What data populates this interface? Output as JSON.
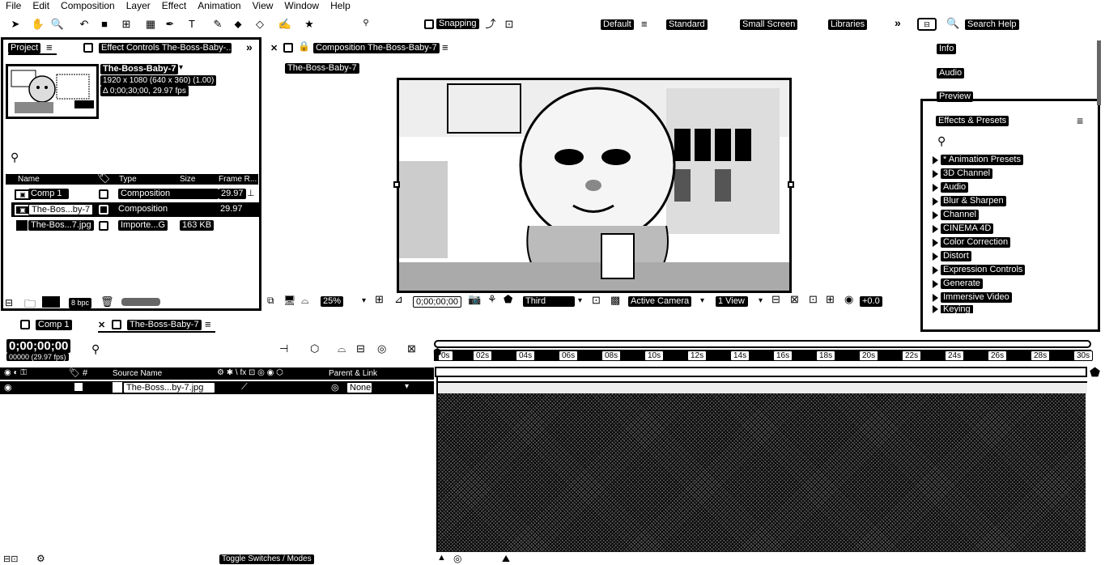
{
  "menu": [
    "File",
    "Edit",
    "Composition",
    "Layer",
    "Effect",
    "Animation",
    "View",
    "Window",
    "Help"
  ],
  "toolbar": {
    "snapping_label": "Snapping",
    "workspaces": [
      "Default",
      "Standard",
      "Small Screen",
      "Libraries"
    ],
    "search_help": "Search Help"
  },
  "project_panel": {
    "tab_project": "Project",
    "tab_effect_controls": "Effect Controls The-Boss-Baby-...",
    "item_name": "The-Boss-Baby-7",
    "item_dimensions": "1920 x 1080  (640 x 360) (1.00)",
    "item_duration": "Δ 0;00;30;00, 29.97 fps",
    "columns": [
      "Name",
      "Type",
      "Size",
      "Frame R..."
    ],
    "rows": [
      {
        "name": "Comp 1",
        "type": "Composition",
        "size": "",
        "frame_rate": "29.97"
      },
      {
        "name": "The-Bos...by-7",
        "type": "Composition",
        "size": "",
        "frame_rate": "29.97"
      },
      {
        "name": "The-Bos...7.jpg",
        "type": "Importe...G",
        "size": "163 KB",
        "frame_rate": ""
      }
    ],
    "bpc": "8 bpc"
  },
  "composition_panel": {
    "tab_title": "Composition The-Boss-Baby-7",
    "breadcrumb": "The-Boss-Baby-7",
    "zoom": "25%",
    "timecode": "0;00;00;00",
    "resolution": "Third",
    "camera": "Active Camera",
    "views": "1 View",
    "exposure": "+0.0"
  },
  "right_panel": {
    "info": "Info",
    "audio": "Audio",
    "preview": "Preview",
    "effects_title": "Effects & Presets",
    "effects": [
      "* Animation Presets",
      "3D Channel",
      "Audio",
      "Blur & Sharpen",
      "Channel",
      "CINEMA 4D",
      "Color Correction",
      "Distort",
      "Expression Controls",
      "Generate",
      "Immersive Video",
      "Keying"
    ]
  },
  "timeline": {
    "tab_comp1": "Comp 1",
    "tab_boss": "The-Boss-Baby-7",
    "timecode": "0;00;00;00",
    "frame_info": "00000 (29.97 fps)",
    "ticks": [
      "0s",
      "02s",
      "04s",
      "06s",
      "08s",
      "10s",
      "12s",
      "14s",
      "16s",
      "18s",
      "20s",
      "22s",
      "24s",
      "26s",
      "28s",
      "30s"
    ],
    "col_source_name": "Source Name",
    "col_parent": "Parent & Link",
    "layer_name": "The-Boss...by-7.jpg",
    "layer_parent": "None",
    "toggle_label": "Toggle Switches / Modes"
  }
}
